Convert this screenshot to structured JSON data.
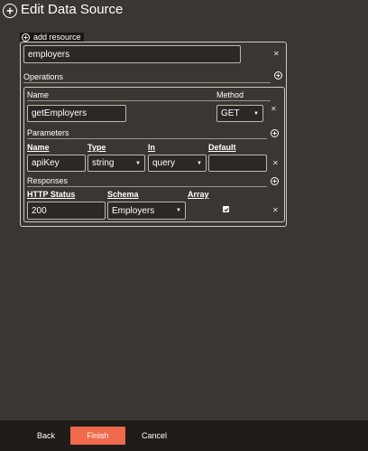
{
  "header": {
    "title": "Edit Data Source",
    "icon": "plus-circle-icon"
  },
  "resource": {
    "tab_label": "add resource",
    "name_value": "employers"
  },
  "operations": {
    "section_label": "Operations",
    "name_label": "Name",
    "method_label": "Method",
    "name_value": "getEmployers",
    "method_value": "GET",
    "parameters": {
      "section_label": "Parameters",
      "columns": [
        "Name",
        "Type",
        "In",
        "Default"
      ],
      "row": {
        "name": "apiKey",
        "type": "string",
        "in": "query",
        "default": ""
      }
    },
    "responses": {
      "section_label": "Responses",
      "columns": [
        "HTTP Status",
        "Schema",
        "Array"
      ],
      "row": {
        "status": "200",
        "schema": "Employers",
        "array_checked": true
      }
    }
  },
  "footer": {
    "back_label": "Back",
    "finish_label": "Finish",
    "cancel_label": "Cancel"
  },
  "colors": {
    "accent": "#f06a4b",
    "background": "#3a3632",
    "footer": "#1f1c1a"
  }
}
